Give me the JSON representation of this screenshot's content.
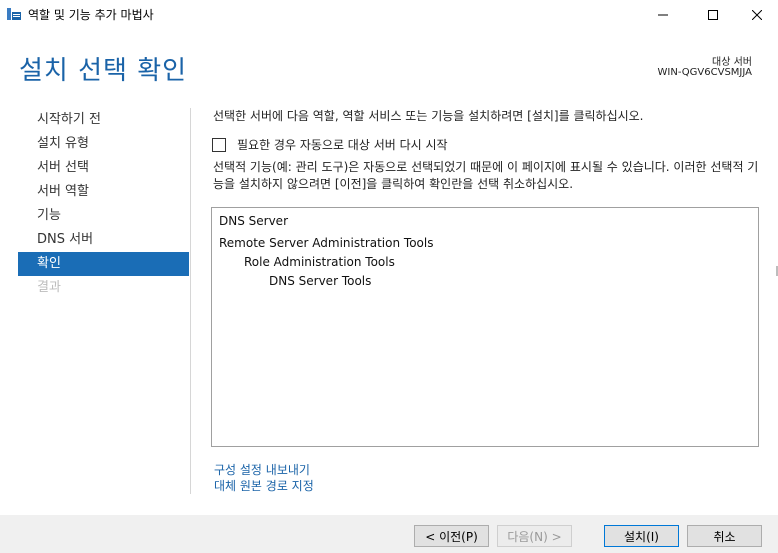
{
  "window": {
    "title": "역할 및 기능 추가 마법사"
  },
  "header": {
    "title": "설치 선택 확인",
    "target_label": "대상 서버",
    "target_name": "WIN-QGV6CVSMJJA"
  },
  "nav": {
    "items": [
      {
        "label": "시작하기 전",
        "state": "normal"
      },
      {
        "label": "설치 유형",
        "state": "normal"
      },
      {
        "label": "서버 선택",
        "state": "normal"
      },
      {
        "label": "서버 역할",
        "state": "normal"
      },
      {
        "label": "기능",
        "state": "normal"
      },
      {
        "label": "DNS 서버",
        "state": "normal"
      },
      {
        "label": "확인",
        "state": "active"
      },
      {
        "label": "결과",
        "state": "disabled"
      }
    ]
  },
  "main": {
    "intro": "선택한 서버에 다음 역할, 역할 서비스 또는 기능을 설치하려면 [설치]를 클릭하십시오.",
    "restart_label": "필요한 경우 자동으로 대상 서버 다시 시작",
    "restart_checked": false,
    "note": "선택적 기능(예: 관리 도구)은 자동으로 선택되었기 때문에 이 페이지에 표시될 수 있습니다. 이러한 선택적 기능을 설치하지 않으려면 [이전]을 클릭하여 확인란을 선택 취소하십시오.",
    "features": [
      {
        "label": "DNS Server",
        "level": 0
      },
      {
        "label": "Remote Server Administration Tools",
        "level": 0
      },
      {
        "label": "Role Administration Tools",
        "level": 1
      },
      {
        "label": "DNS Server Tools",
        "level": 2
      }
    ],
    "links": {
      "export": "구성 설정 내보내기",
      "alternate_source": "대체 원본 경로 지정"
    }
  },
  "footer": {
    "prev": "< 이전(P)",
    "next": "다음(N) >",
    "install": "설치(I)",
    "cancel": "취소"
  },
  "colors": {
    "accent": "#1a63a8",
    "nav_active": "#1a6db6"
  }
}
